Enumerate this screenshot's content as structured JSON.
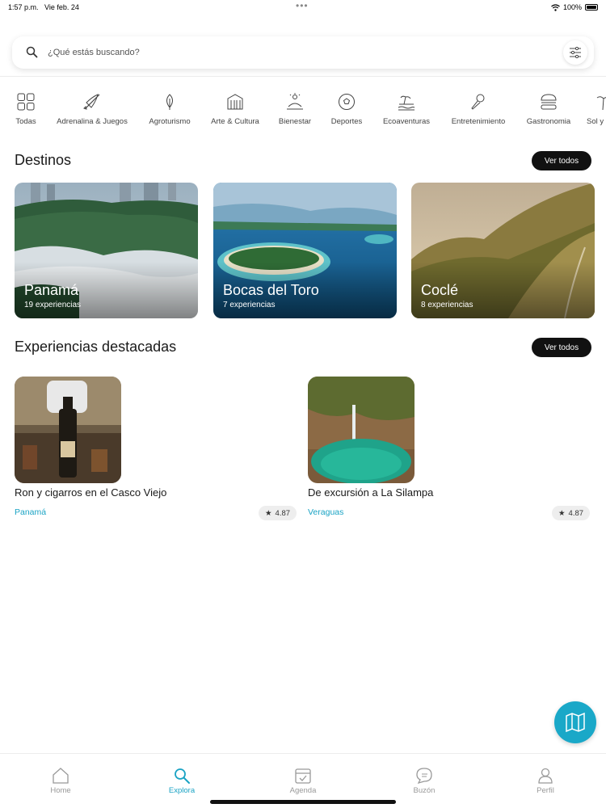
{
  "status_bar": {
    "time": "1:57 p.m.",
    "date": "Vie feb. 24",
    "battery": "100%"
  },
  "search": {
    "placeholder": "¿Qué estás buscando?"
  },
  "categories": [
    {
      "label": "Todas",
      "icon": "grid-icon"
    },
    {
      "label": "Adrenalina & Juegos",
      "icon": "kayak-icon"
    },
    {
      "label": "Agroturismo",
      "icon": "leaf-icon"
    },
    {
      "label": "Arte & Cultura",
      "icon": "building-icon"
    },
    {
      "label": "Bienestar",
      "icon": "wellness-icon"
    },
    {
      "label": "Deportes",
      "icon": "ball-icon"
    },
    {
      "label": "Ecoaventuras",
      "icon": "island-icon"
    },
    {
      "label": "Entretenimiento",
      "icon": "microphone-icon"
    },
    {
      "label": "Gastronomia",
      "icon": "burger-icon"
    },
    {
      "label": "Sol y",
      "icon": "palm-icon"
    }
  ],
  "destinos": {
    "title": "Destinos",
    "see_all": "Ver todos",
    "items": [
      {
        "name": "Panamá",
        "count": "19 experiencias"
      },
      {
        "name": "Bocas del Toro",
        "count": "7 experiencias"
      },
      {
        "name": "Coclé",
        "count": "8 experiencias"
      }
    ]
  },
  "experiencias": {
    "title": "Experiencias destacadas",
    "see_all": "Ver todos",
    "items": [
      {
        "title": "Ron y cigarros en el Casco Viejo",
        "location": "Panamá",
        "rating": "4.87"
      },
      {
        "title": "De excursión a La Silampa",
        "location": "Veraguas",
        "rating": "4.87"
      }
    ]
  },
  "bottom_nav": [
    {
      "label": "Home",
      "icon": "home-icon"
    },
    {
      "label": "Explora",
      "icon": "search-icon",
      "active": true
    },
    {
      "label": "Agenda",
      "icon": "calendar-icon"
    },
    {
      "label": "Buzón",
      "icon": "chat-icon"
    },
    {
      "label": "Perfil",
      "icon": "user-icon"
    }
  ],
  "colors": {
    "accent": "#1aa3c4",
    "fab": "#1aa8c8",
    "button_dark": "#111111"
  }
}
